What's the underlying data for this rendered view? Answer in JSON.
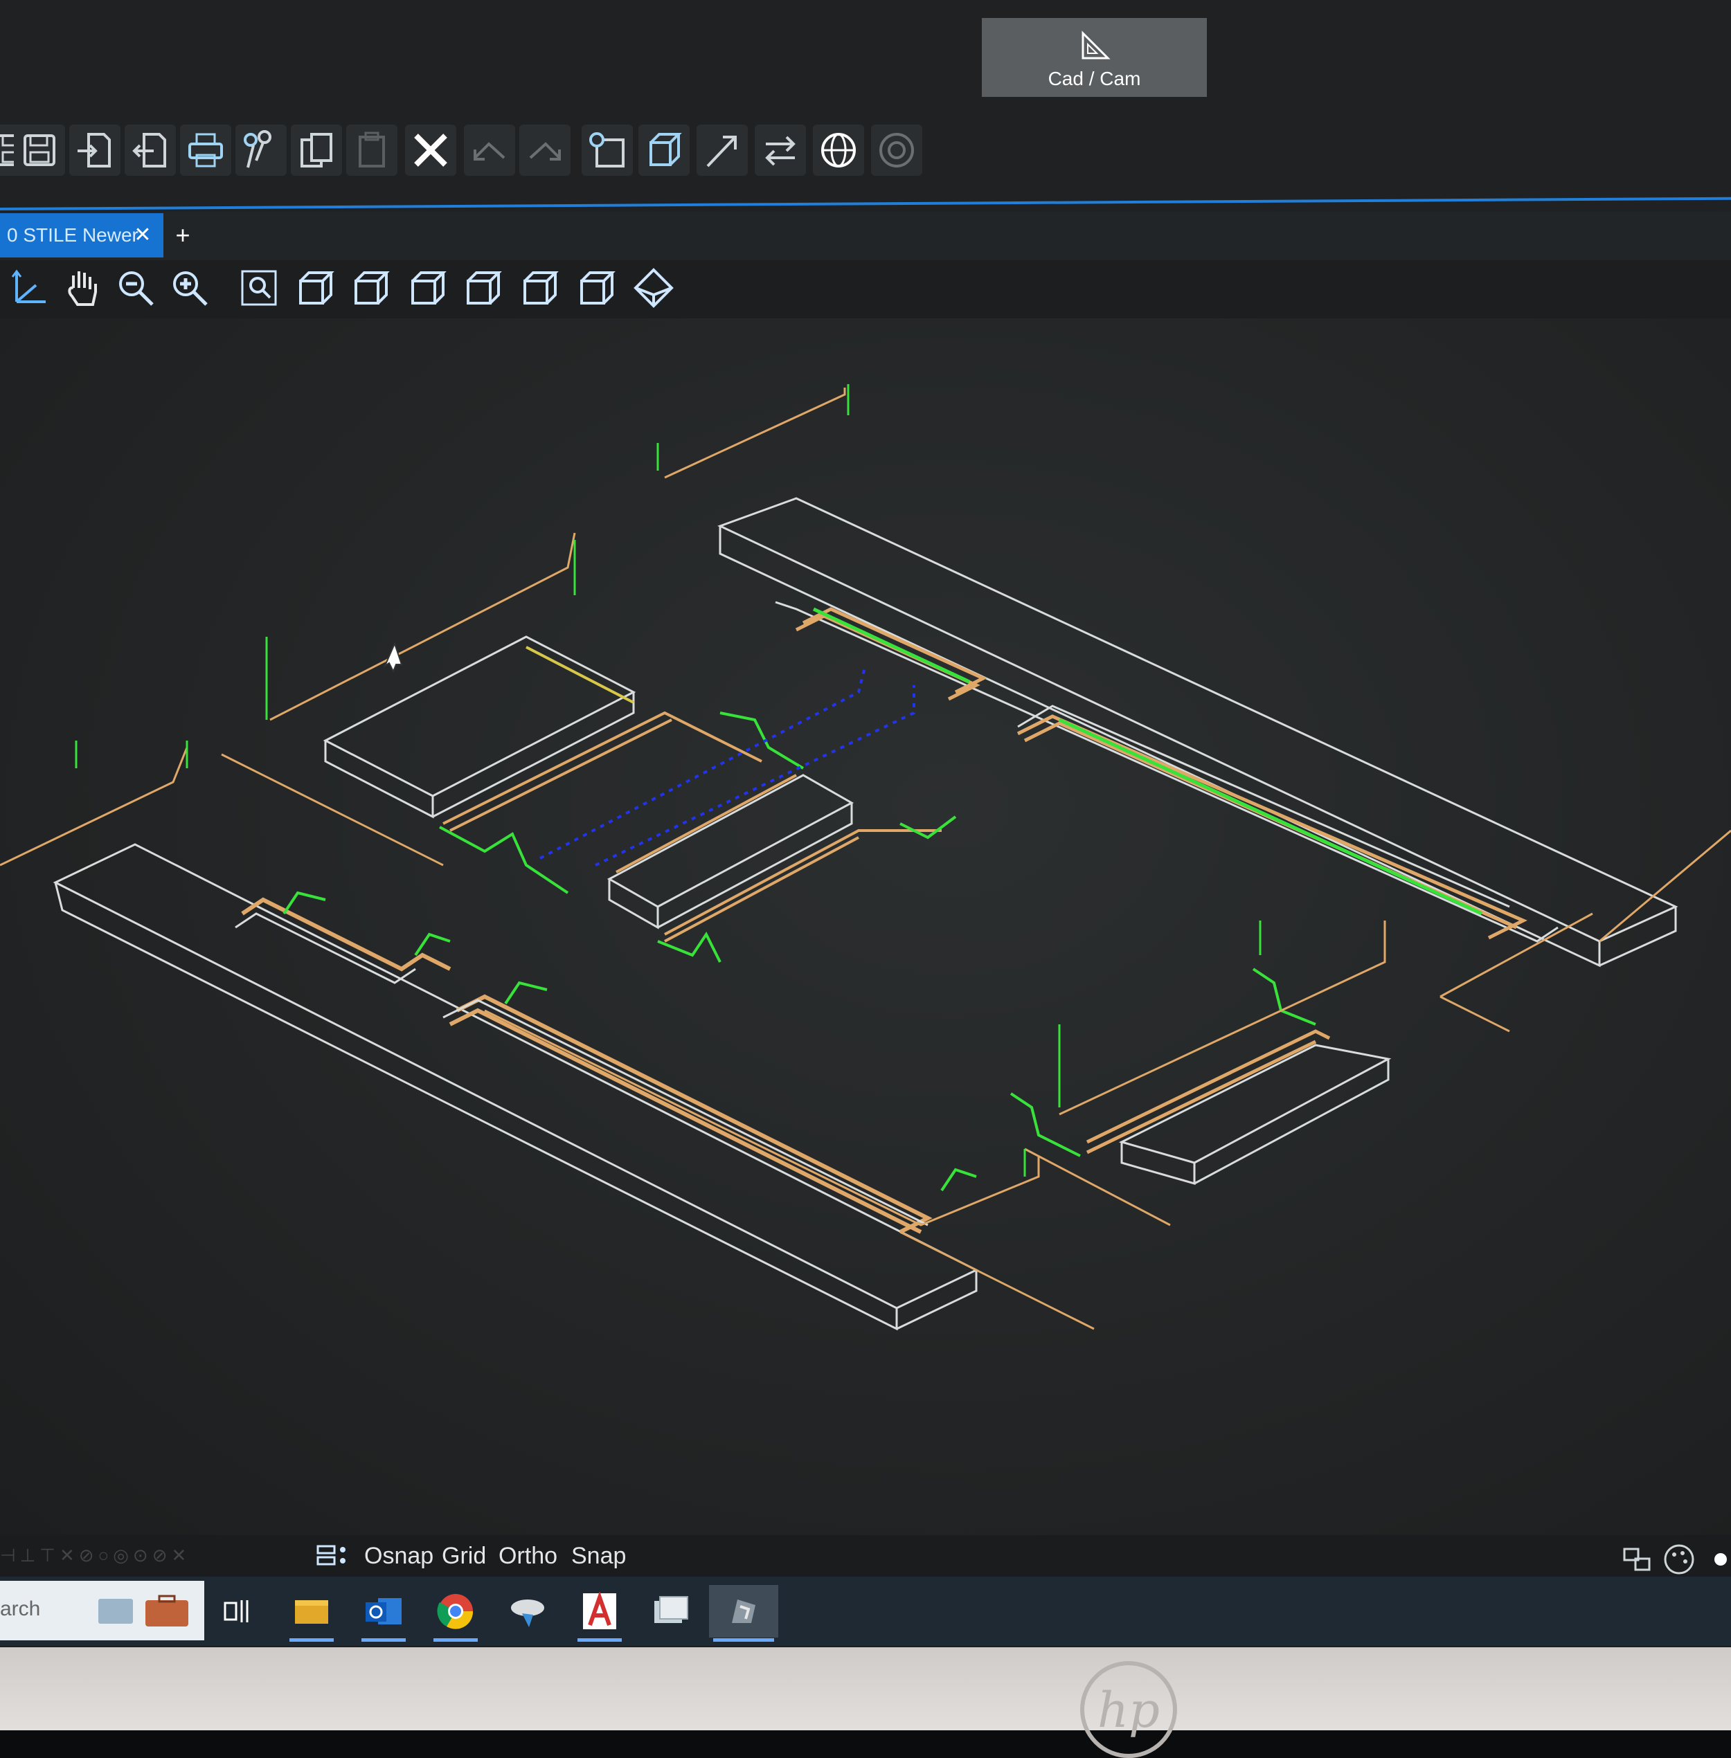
{
  "mode_button": {
    "label": "Cad / Cam",
    "icon": "set-square-icon"
  },
  "toolbar_main": [
    {
      "name": "save-icon"
    },
    {
      "name": "import-icon"
    },
    {
      "name": "export-icon"
    },
    {
      "name": "print-icon"
    },
    {
      "name": "scissors-icon"
    },
    {
      "name": "copy-icon"
    },
    {
      "name": "paste-icon"
    },
    {
      "name": "delete-x-icon"
    },
    {
      "name": "undo-icon"
    },
    {
      "name": "redo-icon"
    },
    {
      "name": "select-window-icon"
    },
    {
      "name": "solid-cube-icon"
    },
    {
      "name": "line-arrow-icon"
    },
    {
      "name": "swap-arrows-icon"
    },
    {
      "name": "sphere-icon"
    },
    {
      "name": "target-icon"
    }
  ],
  "document_tab": {
    "label": "0 STILE Newer",
    "close": "✕",
    "add": "+"
  },
  "toolbar_view": [
    {
      "name": "axes-icon"
    },
    {
      "name": "pan-hand-icon"
    },
    {
      "name": "zoom-out-icon"
    },
    {
      "name": "zoom-in-icon"
    },
    {
      "name": "zoom-window-icon"
    },
    {
      "name": "view-front-cube-icon"
    },
    {
      "name": "view-back-cube-icon"
    },
    {
      "name": "view-left-cube-icon"
    },
    {
      "name": "view-right-cube-icon"
    },
    {
      "name": "view-top-cube-icon"
    },
    {
      "name": "view-bottom-cube-icon"
    },
    {
      "name": "view-iso-icon"
    }
  ],
  "status": {
    "osnap": "Osnap",
    "grid": "Grid",
    "ortho": "Ortho",
    "snap": "Snap"
  },
  "taskbar": {
    "search_text": "arch",
    "apps": [
      "task-view-icon",
      "file-explorer-icon",
      "outlook-icon",
      "chrome-icon",
      "cad-app-icon",
      "acrobat-icon",
      "image-viewer-icon",
      "cam-app-icon"
    ]
  },
  "colors": {
    "accent_blue": "#1773d1",
    "toolpath_orange": "#e0a868",
    "entry_green": "#38e23a",
    "part_outline": "#d9dcdc",
    "rapid_blue": "#2233ee"
  },
  "monitor_brand": "hp"
}
